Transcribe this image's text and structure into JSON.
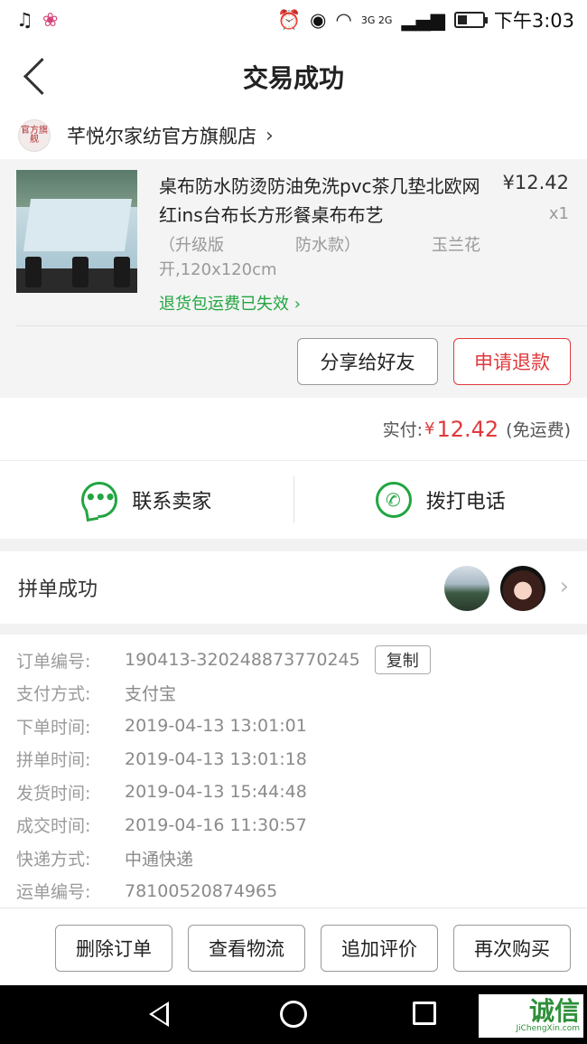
{
  "status_bar": {
    "time": "下午3:03",
    "network": "3G 2G"
  },
  "header": {
    "title": "交易成功"
  },
  "store": {
    "logo_text": "官方旗舰",
    "name": "芊悦尔家纺官方旗舰店",
    "chevron": "›"
  },
  "product": {
    "title": "桌布防水防烫防油免洗pvc茶几垫北欧网红ins台布长方形餐桌布布艺",
    "price": "¥12.42",
    "quantity": "x1",
    "spec_line1": [
      "（升级版",
      "防水款）",
      "玉兰花"
    ],
    "spec_line2": "开,120x120cm",
    "return_note": "退货包运费已失效",
    "share_button": "分享给好友",
    "refund_button": "申请退款"
  },
  "payment": {
    "label": "实付:",
    "currency": "¥",
    "amount": "12.42",
    "shipping": "(免运费)"
  },
  "contact": {
    "seller_label": "联系卖家",
    "phone_label": "拨打电话"
  },
  "group": {
    "label": "拼单成功"
  },
  "order_details": {
    "copy_label": "复制",
    "rows": [
      {
        "label": "订单编号:",
        "value": "190413-320248873770245"
      },
      {
        "label": "支付方式:",
        "value": "支付宝"
      },
      {
        "label": "下单时间:",
        "value": "2019-04-13 13:01:01"
      },
      {
        "label": "拼单时间:",
        "value": "2019-04-13 13:01:18"
      },
      {
        "label": "发货时间:",
        "value": "2019-04-13 15:44:48"
      },
      {
        "label": "成交时间:",
        "value": "2019-04-16 11:30:57"
      },
      {
        "label": "快递方式:",
        "value": "中通快递"
      },
      {
        "label": "运单编号:",
        "value": "78100520874965"
      }
    ]
  },
  "actions": {
    "delete": "删除订单",
    "logistics": "查看物流",
    "review": "追加评价",
    "rebuy": "再次购买"
  },
  "watermark": {
    "main": "诚信",
    "sub": "JiChengXin.com"
  },
  "colors": {
    "accent_red": "#e0393c",
    "accent_green": "#22a540"
  }
}
